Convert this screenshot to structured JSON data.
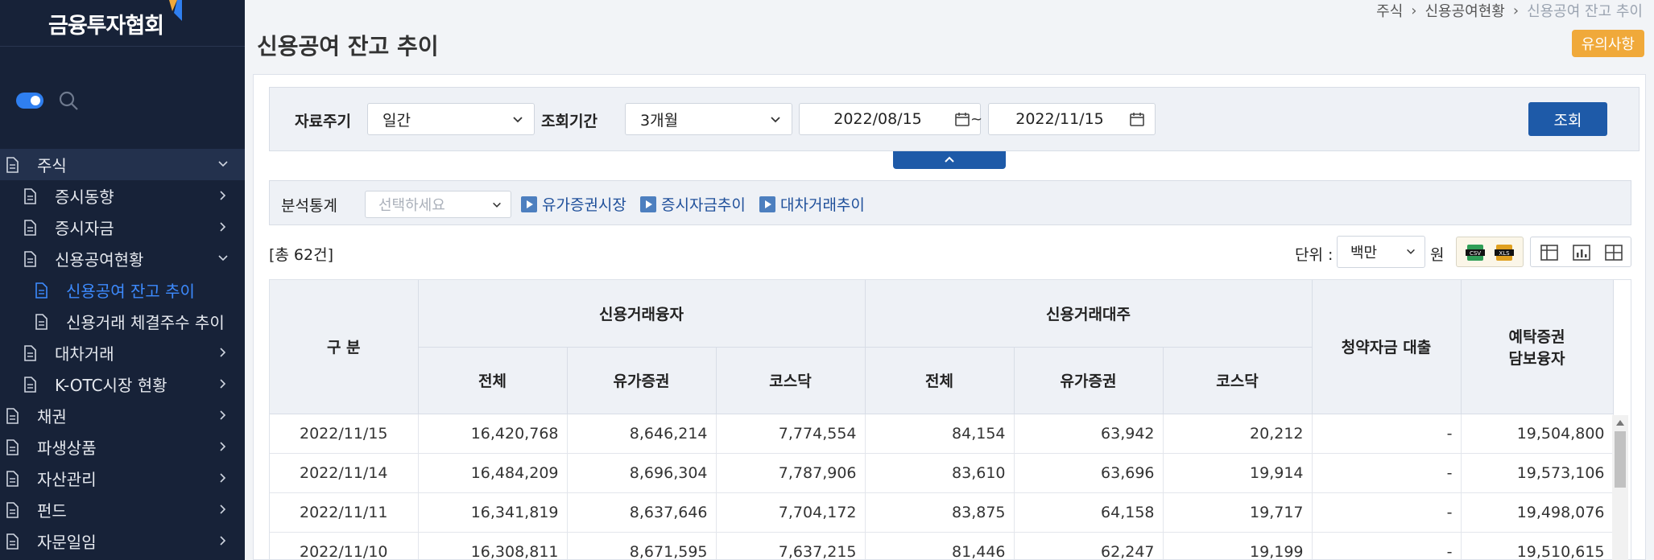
{
  "sidebar": {
    "logo": "금융투자협회",
    "items": [
      {
        "label": "주식",
        "level": 0,
        "open": true
      },
      {
        "label": "증시동향",
        "level": 1
      },
      {
        "label": "증시자금",
        "level": 1
      },
      {
        "label": "신용공여현황",
        "level": 1,
        "open": true
      },
      {
        "label": "신용공여 잔고 추이",
        "level": 2,
        "active": true
      },
      {
        "label": "신용거래 체결주수 추이",
        "level": 2
      },
      {
        "label": "대차거래",
        "level": 1
      },
      {
        "label": "K-OTC시장 현황",
        "level": 1
      },
      {
        "label": "채권",
        "level": 0
      },
      {
        "label": "파생상품",
        "level": 0
      },
      {
        "label": "자산관리",
        "level": 0
      },
      {
        "label": "펀드",
        "level": 0
      },
      {
        "label": "자문일임",
        "level": 0
      }
    ]
  },
  "breadcrumb": [
    "주식",
    "신용공여현황",
    "신용공여 잔고 추이"
  ],
  "page_title": "신용공여 잔고 추이",
  "notice_button": "유의사항",
  "search": {
    "period_label": "자료주기",
    "period_value": "일간",
    "range_label": "조회기간",
    "range_value": "3개월",
    "date_from": "2022/08/15",
    "date_to": "2022/11/15",
    "tilde": "~",
    "query_button": "조회"
  },
  "analysis": {
    "label": "분석통계",
    "placeholder": "선택하세요",
    "links": [
      "유가증권시장",
      "증시자금추이",
      "대차거래추이"
    ]
  },
  "total": "[총 62건]",
  "unit": {
    "label": "단위 :",
    "value": "백만",
    "suffix": "원"
  },
  "table": {
    "header_division": "구 분",
    "group_loan": "신용거래융자",
    "group_lend": "신용거래대주",
    "col_subscription": "청약자금 대출",
    "col_deposit_line1": "예탁증권",
    "col_deposit_line2": "담보융자",
    "sub_total": "전체",
    "sub_kospi": "유가증권",
    "sub_kosdaq": "코스닥",
    "rows": [
      [
        "2022/11/15",
        "16,420,768",
        "8,646,214",
        "7,774,554",
        "84,154",
        "63,942",
        "20,212",
        "-",
        "19,504,800"
      ],
      [
        "2022/11/14",
        "16,484,209",
        "8,696,304",
        "7,787,906",
        "83,610",
        "63,696",
        "19,914",
        "-",
        "19,573,106"
      ],
      [
        "2022/11/11",
        "16,341,819",
        "8,637,646",
        "7,704,172",
        "83,875",
        "64,158",
        "19,717",
        "-",
        "19,498,076"
      ],
      [
        "2022/11/10",
        "16,308,811",
        "8,671,595",
        "7,637,215",
        "81,446",
        "62,247",
        "19,199",
        "-",
        "19,510,615"
      ]
    ]
  }
}
